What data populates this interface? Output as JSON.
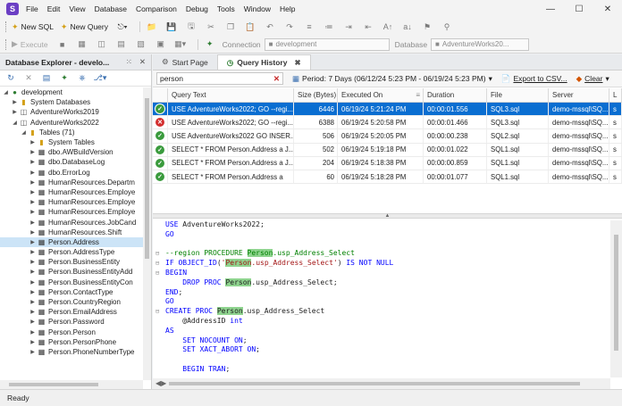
{
  "app": {
    "logo_letter": "S",
    "menu": [
      "File",
      "Edit",
      "View",
      "Database",
      "Comparison",
      "Debug",
      "Tools",
      "Window",
      "Help"
    ]
  },
  "toolbar1": {
    "new_sql": "New SQL",
    "new_query": "New Query"
  },
  "toolbar2": {
    "execute": "Execute",
    "connection_label": "Connection",
    "connection_value": "development",
    "database_label": "Database",
    "database_value": "AdventureWorks20..."
  },
  "database_explorer": {
    "title": "Database Explorer - develo...",
    "tree": [
      {
        "label": "development",
        "level": 0,
        "icon": "server",
        "expanded": true
      },
      {
        "label": "System Databases",
        "level": 1,
        "icon": "folder",
        "expanded": false
      },
      {
        "label": "AdventureWorks2019",
        "level": 1,
        "icon": "database",
        "expanded": false
      },
      {
        "label": "AdventureWorks2022",
        "level": 1,
        "icon": "database",
        "expanded": true
      },
      {
        "label": "Tables (71)",
        "level": 2,
        "icon": "folder",
        "expanded": true
      },
      {
        "label": "System Tables",
        "level": 3,
        "icon": "folder",
        "expanded": false
      },
      {
        "label": "dbo.AWBuildVersion",
        "level": 3,
        "icon": "table",
        "expanded": false
      },
      {
        "label": "dbo.DatabaseLog",
        "level": 3,
        "icon": "table",
        "expanded": false
      },
      {
        "label": "dbo.ErrorLog",
        "level": 3,
        "icon": "table",
        "expanded": false
      },
      {
        "label": "HumanResources.Departm",
        "level": 3,
        "icon": "table",
        "expanded": false
      },
      {
        "label": "HumanResources.Employe",
        "level": 3,
        "icon": "table",
        "expanded": false
      },
      {
        "label": "HumanResources.Employe",
        "level": 3,
        "icon": "table",
        "expanded": false
      },
      {
        "label": "HumanResources.Employe",
        "level": 3,
        "icon": "table",
        "expanded": false
      },
      {
        "label": "HumanResources.JobCand",
        "level": 3,
        "icon": "table",
        "expanded": false
      },
      {
        "label": "HumanResources.Shift",
        "level": 3,
        "icon": "table",
        "expanded": false
      },
      {
        "label": "Person.Address",
        "level": 3,
        "icon": "table",
        "expanded": false,
        "selected": true
      },
      {
        "label": "Person.AddressType",
        "level": 3,
        "icon": "table",
        "expanded": false
      },
      {
        "label": "Person.BusinessEntity",
        "level": 3,
        "icon": "table",
        "expanded": false
      },
      {
        "label": "Person.BusinessEntityAdd",
        "level": 3,
        "icon": "table",
        "expanded": false
      },
      {
        "label": "Person.BusinessEntityCon",
        "level": 3,
        "icon": "table",
        "expanded": false
      },
      {
        "label": "Person.ContactType",
        "level": 3,
        "icon": "table",
        "expanded": false
      },
      {
        "label": "Person.CountryRegion",
        "level": 3,
        "icon": "table",
        "expanded": false
      },
      {
        "label": "Person.EmailAddress",
        "level": 3,
        "icon": "table",
        "expanded": false
      },
      {
        "label": "Person.Password",
        "level": 3,
        "icon": "table",
        "expanded": false
      },
      {
        "label": "Person.Person",
        "level": 3,
        "icon": "table",
        "expanded": false
      },
      {
        "label": "Person.PersonPhone",
        "level": 3,
        "icon": "table",
        "expanded": false
      },
      {
        "label": "Person.PhoneNumberType",
        "level": 3,
        "icon": "table",
        "expanded": false
      }
    ]
  },
  "tabs": {
    "start_page": "Start Page",
    "query_history": "Query History"
  },
  "filter": {
    "search_value": "person",
    "period": "Period: 7 Days (06/12/24 5:23 PM - 06/19/24 5:23 PM)",
    "export": "Export to CSV...",
    "clear": "Clear"
  },
  "grid": {
    "columns": [
      "Query Text",
      "Size (Bytes)",
      "Executed On",
      "Duration",
      "File",
      "Server",
      "L"
    ],
    "rows": [
      {
        "status": "ok",
        "text": "USE AdventureWorks2022; GO --regi...",
        "size": "6446",
        "executed": "06/19/24 5:21:24 PM",
        "duration": "00:00:01.556",
        "file": "SQL3.sql",
        "server": "demo-mssql\\SQ...",
        "l": "s",
        "selected": true
      },
      {
        "status": "err",
        "text": "USE AdventureWorks2022; GO --regi...",
        "size": "6388",
        "executed": "06/19/24 5:20:58 PM",
        "duration": "00:00:01.466",
        "file": "SQL3.sql",
        "server": "demo-mssql\\SQ...",
        "l": "s"
      },
      {
        "status": "ok",
        "text": "USE AdventureWorks2022 GO INSER...",
        "size": "506",
        "executed": "06/19/24 5:20:05 PM",
        "duration": "00:00:00.238",
        "file": "SQL2.sql",
        "server": "demo-mssql\\SQ...",
        "l": "s"
      },
      {
        "status": "ok",
        "text": "SELECT * FROM Person.Address a J...",
        "size": "502",
        "executed": "06/19/24 5:19:18 PM",
        "duration": "00:00:01.022",
        "file": "SQL1.sql",
        "server": "demo-mssql\\SQ...",
        "l": "s"
      },
      {
        "status": "ok",
        "text": "SELECT * FROM Person.Address a J...",
        "size": "204",
        "executed": "06/19/24 5:18:38 PM",
        "duration": "00:00:00.859",
        "file": "SQL1.sql",
        "server": "demo-mssql\\SQ...",
        "l": "s"
      },
      {
        "status": "ok",
        "text": "SELECT * FROM Person.Address a",
        "size": "60",
        "executed": "06/19/24 5:18:28 PM",
        "duration": "00:00:01.077",
        "file": "SQL1.sql",
        "server": "demo-mssql\\SQ...",
        "l": "s"
      }
    ]
  },
  "code": {
    "lines": [
      [
        {
          "t": "USE",
          "c": "kw"
        },
        {
          "t": " AdventureWorks2022;"
        }
      ],
      [
        {
          "t": "GO",
          "c": "kw"
        }
      ],
      [],
      [
        {
          "t": "--region PROCEDURE ",
          "c": "cm",
          "fold": true
        },
        {
          "t": "Person",
          "c": "cm hl"
        },
        {
          "t": ".usp_Address_Select",
          "c": "cm"
        }
      ],
      [
        {
          "t": "IF",
          "c": "kw",
          "fold": true
        },
        {
          "t": " "
        },
        {
          "t": "OBJECT_ID",
          "c": "kw"
        },
        {
          "t": "("
        },
        {
          "t": "'",
          "c": "str"
        },
        {
          "t": "Person",
          "c": "str hl"
        },
        {
          "t": ".usp_Address_Select'",
          "c": "str"
        },
        {
          "t": ") "
        },
        {
          "t": "IS NOT NULL",
          "c": "kw"
        }
      ],
      [
        {
          "t": "BEGIN",
          "c": "kw",
          "fold": true
        }
      ],
      [
        {
          "t": "    "
        },
        {
          "t": "DROP PROC",
          "c": "kw"
        },
        {
          "t": " "
        },
        {
          "t": "Person",
          "c": "hl"
        },
        {
          "t": ".usp_Address_Select;"
        }
      ],
      [
        {
          "t": "END",
          "c": "kw"
        },
        {
          "t": ";"
        }
      ],
      [
        {
          "t": "GO",
          "c": "kw"
        }
      ],
      [
        {
          "t": "CREATE PROC",
          "c": "kw",
          "fold": true
        },
        {
          "t": " "
        },
        {
          "t": "Person",
          "c": "hl"
        },
        {
          "t": ".usp_Address_Select"
        }
      ],
      [
        {
          "t": "    @AddressID "
        },
        {
          "t": "int",
          "c": "kw"
        }
      ],
      [
        {
          "t": "AS",
          "c": "kw"
        }
      ],
      [
        {
          "t": "    "
        },
        {
          "t": "SET NOCOUNT ON",
          "c": "kw"
        },
        {
          "t": ";"
        }
      ],
      [
        {
          "t": "    "
        },
        {
          "t": "SET XACT_ABORT ON",
          "c": "kw"
        },
        {
          "t": ";"
        }
      ],
      [],
      [
        {
          "t": "    "
        },
        {
          "t": "BEGIN TRAN",
          "c": "kw"
        },
        {
          "t": ";"
        }
      ]
    ]
  },
  "statusbar": {
    "text": "Ready"
  },
  "colors": {
    "selection": "#0a6ed1",
    "success": "#3a9b3d",
    "error": "#d32f2f",
    "highlight": "#8fd48f",
    "brand": "#6b3fc4"
  }
}
